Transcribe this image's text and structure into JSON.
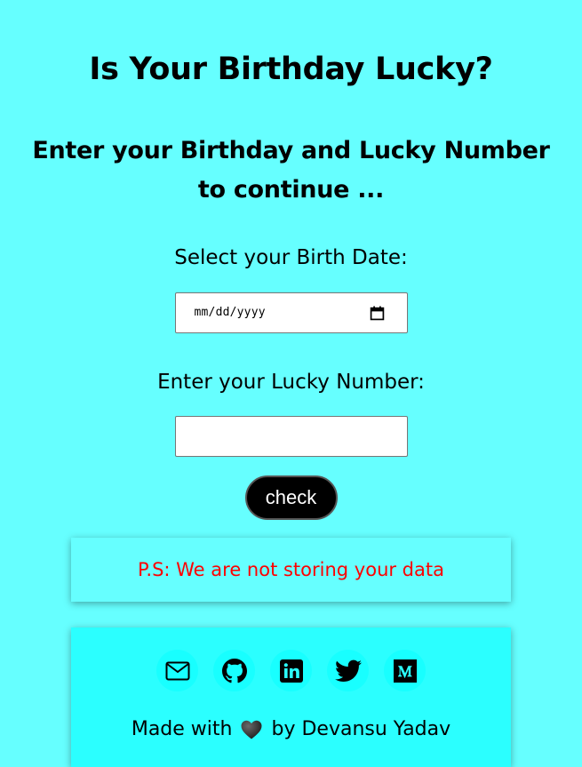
{
  "header": {
    "title": "Is Your Birthday Lucky?",
    "subtitle": "Enter your Birthday and Lucky Number to continue ..."
  },
  "form": {
    "birth_label": "Select your Birth Date:",
    "date_placeholder": "mm/dd/yyyy",
    "lucky_label": "Enter your Lucky Number:",
    "lucky_value": "",
    "check_label": "check"
  },
  "notice": {
    "text": "P.S: We are not storing your data"
  },
  "footer": {
    "social_icons": [
      "mail-icon",
      "github-icon",
      "linkedin-icon",
      "twitter-icon",
      "medium-icon"
    ],
    "made_prefix": "Made with",
    "made_suffix": "by Devansu Yadav"
  },
  "colors": {
    "background": "#66ffff",
    "footer_background": "#2bffff",
    "notice_text": "#ff0000",
    "button_background": "#000000"
  }
}
